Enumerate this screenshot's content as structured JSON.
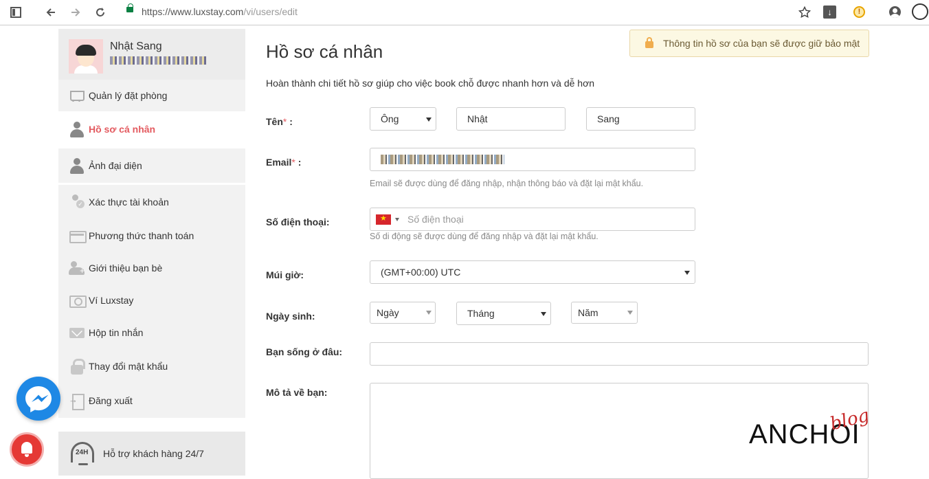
{
  "browser": {
    "url_prefix": "https://www.luxstay.com",
    "url_path": "/vi/users/edit"
  },
  "notice": {
    "text": "Thông tin hồ sơ của bạn sẽ được giữ bảo mật"
  },
  "profile": {
    "name": "Nhật Sang"
  },
  "sidebar": {
    "items": [
      {
        "label": "Quản lý đặt phòng",
        "icon": "cart-icon"
      },
      {
        "label": "Hồ sơ cá nhân",
        "icon": "person-icon",
        "active": true
      },
      {
        "label": "Ảnh đại diện",
        "icon": "person-icon"
      },
      {
        "label": "Xác thực tài khoản",
        "icon": "verify-user-icon"
      },
      {
        "label": "Phương thức thanh toán",
        "icon": "card-icon"
      },
      {
        "label": "Giới thiệu bạn bè",
        "icon": "add-friend-icon"
      },
      {
        "label": "Ví Luxstay",
        "icon": "wallet-icon"
      },
      {
        "label": "Hộp tin nhắn",
        "icon": "mail-icon"
      },
      {
        "label": "Thay đổi mật khẩu",
        "icon": "lock-icon"
      },
      {
        "label": "Đăng xuất",
        "icon": "logout-icon"
      }
    ],
    "support": {
      "label": "Hỗ trợ khách hàng 24/7",
      "badge": "24H"
    }
  },
  "form": {
    "title": "Hồ sơ cá nhân",
    "intro": "Hoàn thành chi tiết hồ sơ giúp cho việc book chỗ được nhanh hơn và dễ hơn",
    "name": {
      "label": "Tên",
      "suffix": " :",
      "salutation": "Ông",
      "first": "Nhật",
      "last": "Sang"
    },
    "email": {
      "label": "Email",
      "suffix": " :",
      "hint": "Email sẽ được dùng để đăng nhập, nhận thông báo và đặt lại mật khẩu."
    },
    "phone": {
      "label": "Số điện thoại:",
      "placeholder": "Số điện thoại",
      "hint": "Số di động sẽ được dùng để đăng nhập và đặt lại mật khẩu."
    },
    "timezone": {
      "label": "Múi giờ:",
      "value": "(GMT+00:00) UTC"
    },
    "birthday": {
      "label": "Ngày sinh:",
      "day": "Ngày",
      "month": "Tháng",
      "year": "Năm"
    },
    "location": {
      "label": "Bạn sống ở đâu:",
      "value": ""
    },
    "about": {
      "label": "Mô tả về bạn:",
      "value": ""
    }
  },
  "watermark": {
    "main": "ANCHOI",
    "small": "blog"
  }
}
